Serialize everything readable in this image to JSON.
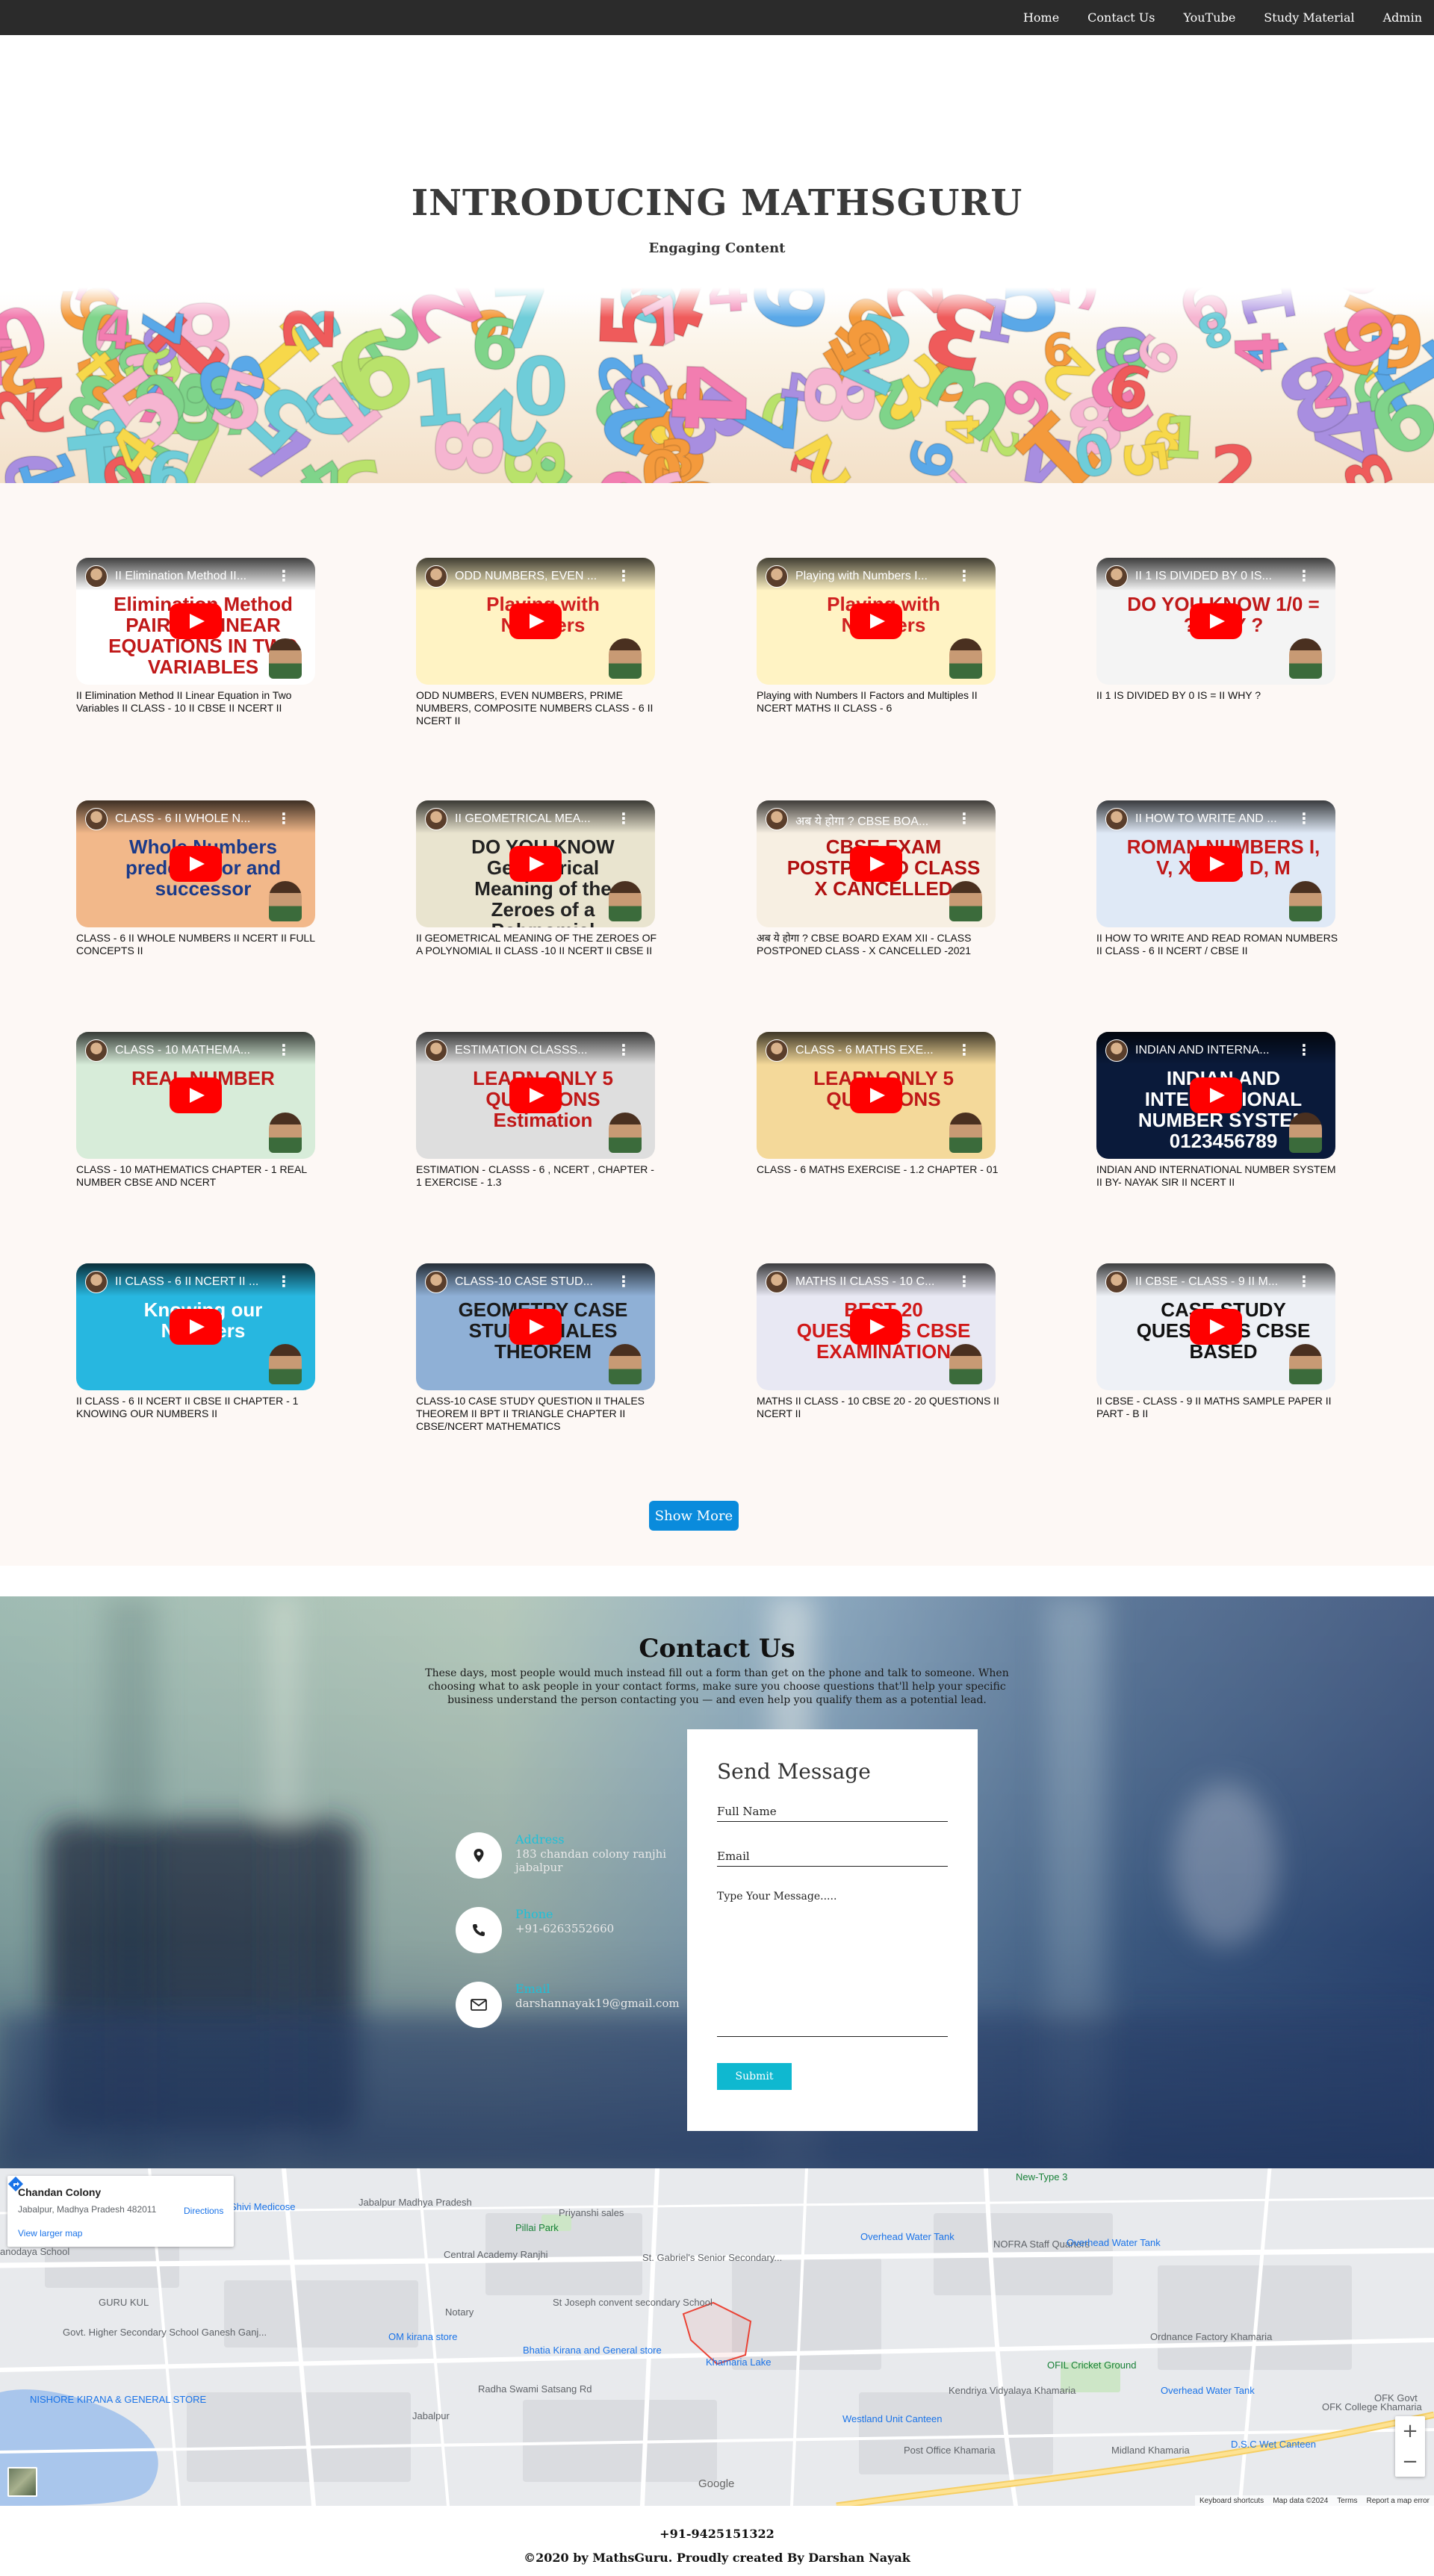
{
  "nav": {
    "items": [
      "Home",
      "Contact Us",
      "YouTube",
      "Study Material",
      "Admin"
    ]
  },
  "hero": {
    "title": "INTRODUCING MATHSGURU",
    "subtitle": "Engaging Content"
  },
  "videos": [
    {
      "title": "II Elimination Method II Linear Equation in Two Variables II CLASS - 10 II CBSE II NCERT II",
      "thumb_title": "II Elimination Method II...",
      "headline": "Elimination Method PAIR OF LINEAR EQUATIONS IN TWO VARIABLES",
      "bg": "#ffffff",
      "fg": "#c01818"
    },
    {
      "title": "ODD NUMBERS, EVEN NUMBERS, PRIME NUMBERS, COMPOSITE NUMBERS CLASS - 6 II NCERT II",
      "thumb_title": "ODD NUMBERS, EVEN ...",
      "headline": "Playing with Numbers",
      "bg": "#fff3c4",
      "fg": "#d02020"
    },
    {
      "title": "Playing with Numbers II Factors and Multiples II NCERT MATHS II CLASS - 6",
      "thumb_title": "Playing with Numbers I...",
      "headline": "Playing with Numbers",
      "bg": "#fff3c4",
      "fg": "#d02020"
    },
    {
      "title": "II 1 IS DIVIDED BY 0 IS = II WHY ?",
      "thumb_title": "II 1 IS DIVIDED BY 0 IS...",
      "headline": "DO YOU KNOW 1/0 = ? WHY ?",
      "bg": "#f4f4f4",
      "fg": "#c01818"
    },
    {
      "title": "CLASS - 6 II WHOLE NUMBERS II NCERT II FULL CONCEPTS II",
      "thumb_title": "CLASS - 6 II WHOLE N...",
      "headline": "Whole Numbers predecessor and successor",
      "bg": "#f2b88a",
      "fg": "#1a3a8a"
    },
    {
      "title": "II GEOMETRICAL MEANING OF THE ZEROES OF A POLYNOMIAL II CLASS -10 II NCERT II CBSE II",
      "thumb_title": "II GEOMETRICAL MEA...",
      "headline": "DO YOU KNOW Geometrical Meaning of the Zeroes of a Polynomial",
      "bg": "#e9e4cf",
      "fg": "#222222"
    },
    {
      "title": "अब ये होगा ? CBSE BOARD EXAM XII - CLASS POSTPONED CLASS - X CANCELLED -2021",
      "thumb_title": "अब ये होगा ? CBSE BOA...",
      "headline": "CBSE EXAM POSTPONED CLASS X CANCELLED",
      "bg": "#f7efe2",
      "fg": "#b01010"
    },
    {
      "title": "II HOW TO WRITE AND READ ROMAN NUMBERS II CLASS - 6 II NCERT / CBSE II",
      "thumb_title": "II HOW TO WRITE AND ...",
      "headline": "ROMAN NUMBERS I, V, X, L, C, D, M",
      "bg": "#dfe9f6",
      "fg": "#c01818"
    },
    {
      "title": "CLASS - 10 MATHEMATICS CHAPTER - 1 REAL NUMBER CBSE AND NCERT",
      "thumb_title": "CLASS - 10 MATHEMA...",
      "headline": "REAL NUMBER",
      "bg": "#d7ecd9",
      "fg": "#c01818"
    },
    {
      "title": "ESTIMATION - CLASSS - 6 , NCERT , CHAPTER - 1 EXERCISE - 1.3",
      "thumb_title": "ESTIMATION CLASSS...",
      "headline": "LEARN ONLY 5 QUESTIONS Estimation",
      "bg": "#dedede",
      "fg": "#c01818"
    },
    {
      "title": "CLASS - 6 MATHS EXERCISE - 1.2 CHAPTER - 01",
      "thumb_title": "CLASS - 6 MATHS EXE...",
      "headline": "LEARN ONLY 5 QUESTIONS",
      "bg": "#f4d99a",
      "fg": "#c01818"
    },
    {
      "title": "INDIAN AND INTERNATIONAL NUMBER SYSTEM II BY- NAYAK SIR II NCERT II",
      "thumb_title": "INDIAN AND INTERNA...",
      "headline": "INDIAN AND INTERNATIONAL NUMBER SYSTEM 0123456789",
      "bg": "#0a1a3a",
      "fg": "#ffffff"
    },
    {
      "title": "II CLASS - 6 II NCERT II CBSE II CHAPTER - 1 KNOWING OUR NUMBERS II",
      "thumb_title": "II CLASS - 6 II NCERT II ...",
      "headline": "Knowing our Numbers",
      "bg": "#27b7e0",
      "fg": "#ffffff"
    },
    {
      "title": "CLASS-10 CASE STUDY QUESTION II THALES THEOREM II BPT II TRIANGLE CHAPTER II CBSE/NCERT MATHEMATICS",
      "thumb_title": "CLASS-10 CASE STUD...",
      "headline": "GEOMETRY CASE STUDY THALES THEOREM",
      "bg": "#8fb0d6",
      "fg": "#1a1a1a"
    },
    {
      "title": "MATHS II CLASS - 10 CBSE 20 - 20 QUESTIONS II NCERT II",
      "thumb_title": "MATHS II CLASS - 10 C...",
      "headline": "BEST 20 QUESTIONS CBSE EXAMINATION",
      "bg": "#e8e8f3",
      "fg": "#d01818"
    },
    {
      "title": "II CBSE - CLASS - 9 II MATHS SAMPLE PAPER II PART - B II",
      "thumb_title": "II CBSE - CLASS - 9 II M...",
      "headline": "CASE STUDY QUESTIONS CBSE BASED",
      "bg": "#eef1f6",
      "fg": "#111111"
    }
  ],
  "show_more_label": "Show More",
  "contact": {
    "title": "Contact Us",
    "description": "These days, most people would much instead fill out a form than get on the phone and talk to someone. When choosing what to ask people in your contact forms, make sure you choose questions that'll help your specific business understand the person contacting you — and even help you qualify them as a potential lead.",
    "address_label": "Address",
    "address_value": "183 chandan colony ranjhi jabalpur",
    "phone_label": "Phone",
    "phone_value": "+91-6263552660",
    "email_label": "Email",
    "email_value": "darshannayak19@gmail.com",
    "form": {
      "title": "Send Message",
      "name_placeholder": "Full Name",
      "email_placeholder": "Email",
      "message_placeholder": "Type Your Message.....",
      "submit_label": "Submit"
    }
  },
  "map": {
    "place_name": "Chandan Colony",
    "place_address": "Jabalpur, Madhya Pradesh 482011",
    "directions_label": "Directions",
    "larger_map_label": "View larger map",
    "zoom_in": "+",
    "zoom_out": "−",
    "google": "Google",
    "keyboard": "Keyboard shortcuts",
    "map_data": "Map data ©2024",
    "terms": "Terms",
    "report": "Report a map error",
    "labels": [
      {
        "text": "Jabalpur Madhya Pradesh",
        "color": "#5f6368"
      },
      {
        "text": "Priyanshi sales",
        "color": "#5f6368"
      },
      {
        "text": "Shivi Medicose",
        "color": "#1a73e8"
      },
      {
        "text": "Pillai Park",
        "color": "#188038"
      },
      {
        "text": "Central Academy Ranjhi",
        "color": "#5f6368"
      },
      {
        "text": "St. Gabriel's Senior Secondary...",
        "color": "#5f6368"
      },
      {
        "text": "St Joseph convent secondary School",
        "color": "#5f6368"
      },
      {
        "text": "GURU KUL",
        "color": "#5f6368"
      },
      {
        "text": "Notary",
        "color": "#5f6368"
      },
      {
        "text": "Govt. Higher Secondary School Ganesh Ganj...",
        "color": "#5f6368"
      },
      {
        "text": "OM kirana store",
        "color": "#1a73e8"
      },
      {
        "text": "Bhatia Kirana and General store",
        "color": "#1a73e8"
      },
      {
        "text": "Khamaria Lake",
        "color": "#1a73e8"
      },
      {
        "text": "NISHORE KIRANA & GENERAL STORE",
        "color": "#1a73e8"
      },
      {
        "text": "Radha Swami Satsang Rd",
        "color": "#5f6368"
      },
      {
        "text": "Jabalpur",
        "color": "#5f6368"
      },
      {
        "text": "New-Type 3",
        "color": "#188038"
      },
      {
        "text": "Overhead Water Tank",
        "color": "#1a73e8"
      },
      {
        "text": "NOFRA Staff Quarters",
        "color": "#5f6368"
      },
      {
        "text": "Overhead Water Tank",
        "color": "#1a73e8"
      },
      {
        "text": "Kendriya Vidyalaya Khamaria",
        "color": "#5f6368"
      },
      {
        "text": "OFIL Cricket Ground",
        "color": "#188038"
      },
      {
        "text": "Ordnance Factory Khamaria",
        "color": "#5f6368"
      },
      {
        "text": "Westland Unit Canteen",
        "color": "#1a73e8"
      },
      {
        "text": "Post Office Khamaria",
        "color": "#5f6368"
      },
      {
        "text": "Midland Khamaria",
        "color": "#5f6368"
      },
      {
        "text": "D.S.C Wet Canteen",
        "color": "#1a73e8"
      },
      {
        "text": "OFK College Khamaria",
        "color": "#5f6368"
      },
      {
        "text": "OFK Govt",
        "color": "#5f6368"
      },
      {
        "text": "Overhead Water Tank",
        "color": "#1a73e8"
      },
      {
        "text": "anodaya School",
        "color": "#5f6368"
      }
    ]
  },
  "footer": {
    "phone": "+91-9425151322",
    "copyright": "©2020 by MathsGuru. Proudly created By Darshan Nayak"
  }
}
